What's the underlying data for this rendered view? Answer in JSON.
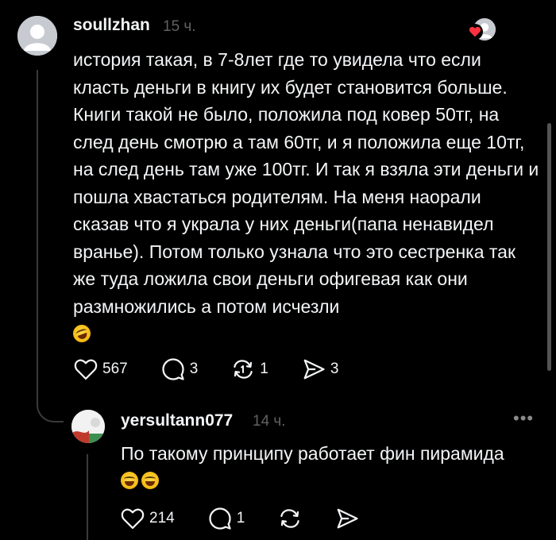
{
  "post": {
    "author": "soullzhan",
    "time": "15 ч.",
    "text": "история такая, в 7-8лет где то увидела что если класть деньги в книгу их будет становится больше. Книги такой не было, положила под ковер 50тг, на след день смотрю а там 60тг, и я положила еще 10тг, на след день там уже 100тг. И так я взяла эти деньги и пошла хвастаться родителям. На меня наорали сказав что я украла у них деньги(папа ненавидел вранье). Потом только узнала что это сестренка так же туда ложила свои деньги офигевая как они размножились а потом исчезли",
    "emoji": "rolling-on-floor-laughing",
    "likes": "567",
    "comments": "3",
    "reposts": "1",
    "shares": "3"
  },
  "reply": {
    "author": "yersultann077",
    "time": "14 ч.",
    "more": "•••",
    "text": "По такому принципу работает фин пирамида",
    "emoji": "face-with-tears-of-joy",
    "likes": "214",
    "comments": "1"
  },
  "icons": [
    "heart-icon",
    "comment-icon",
    "repost-icon",
    "share-icon"
  ],
  "colors": {
    "background": "#000000",
    "text": "#f3f5f7",
    "muted": "#616161",
    "accent_heart": "#ff3040"
  }
}
